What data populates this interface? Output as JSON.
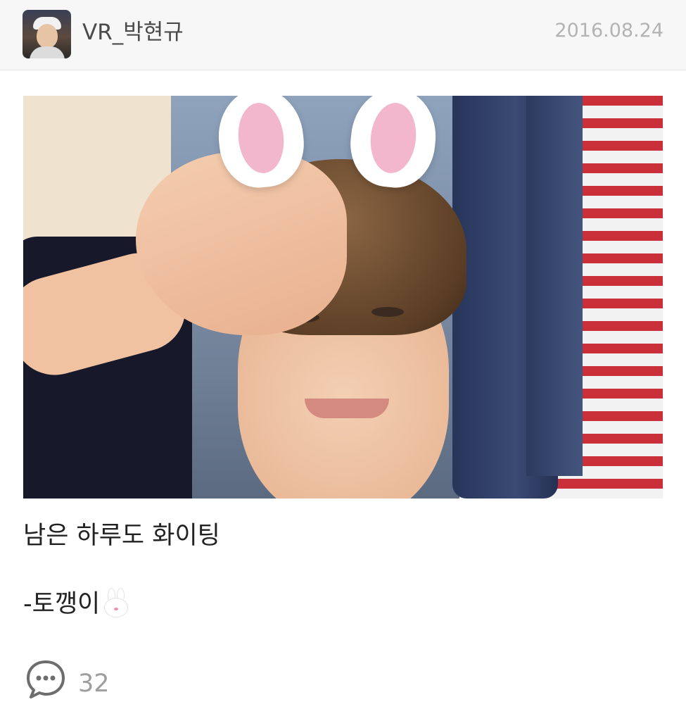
{
  "header": {
    "username": "VR_박현규",
    "date": "2016.08.24"
  },
  "post": {
    "caption_line_1": "남은 하루도 화이팅",
    "caption_line_2": "-토깽이",
    "caption_emoji": "rabbit-face-emoji"
  },
  "footer": {
    "comment_icon": "speech-bubble-ellipsis-icon",
    "comment_count": "32"
  }
}
